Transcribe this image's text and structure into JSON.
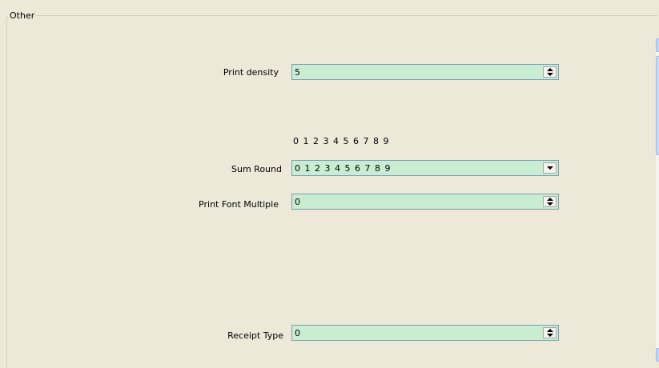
{
  "group": {
    "title": "Other"
  },
  "fields": {
    "print_density": {
      "label": "Print density",
      "value": "5"
    },
    "sum_round": {
      "label": "Sum Round",
      "scale": "0 1 2 3 4 5 6 7 8 9",
      "value": "0 1 2 3 4 5 6 7 8 9"
    },
    "print_font_multiple": {
      "label": "Print Font Multiple",
      "value": "0"
    },
    "receipt_type": {
      "label": "Receipt Type",
      "value": "0"
    }
  },
  "colors": {
    "field_bg": "#c9edd0",
    "panel_bg": "#ece9d8",
    "scroll_accent": "#c1d3fb"
  },
  "icons": {
    "spinner": "spinner-icon",
    "dropdown": "dropdown-arrow-icon",
    "scroll_up": "scroll-up-icon",
    "scroll_down": "scroll-down-icon"
  }
}
